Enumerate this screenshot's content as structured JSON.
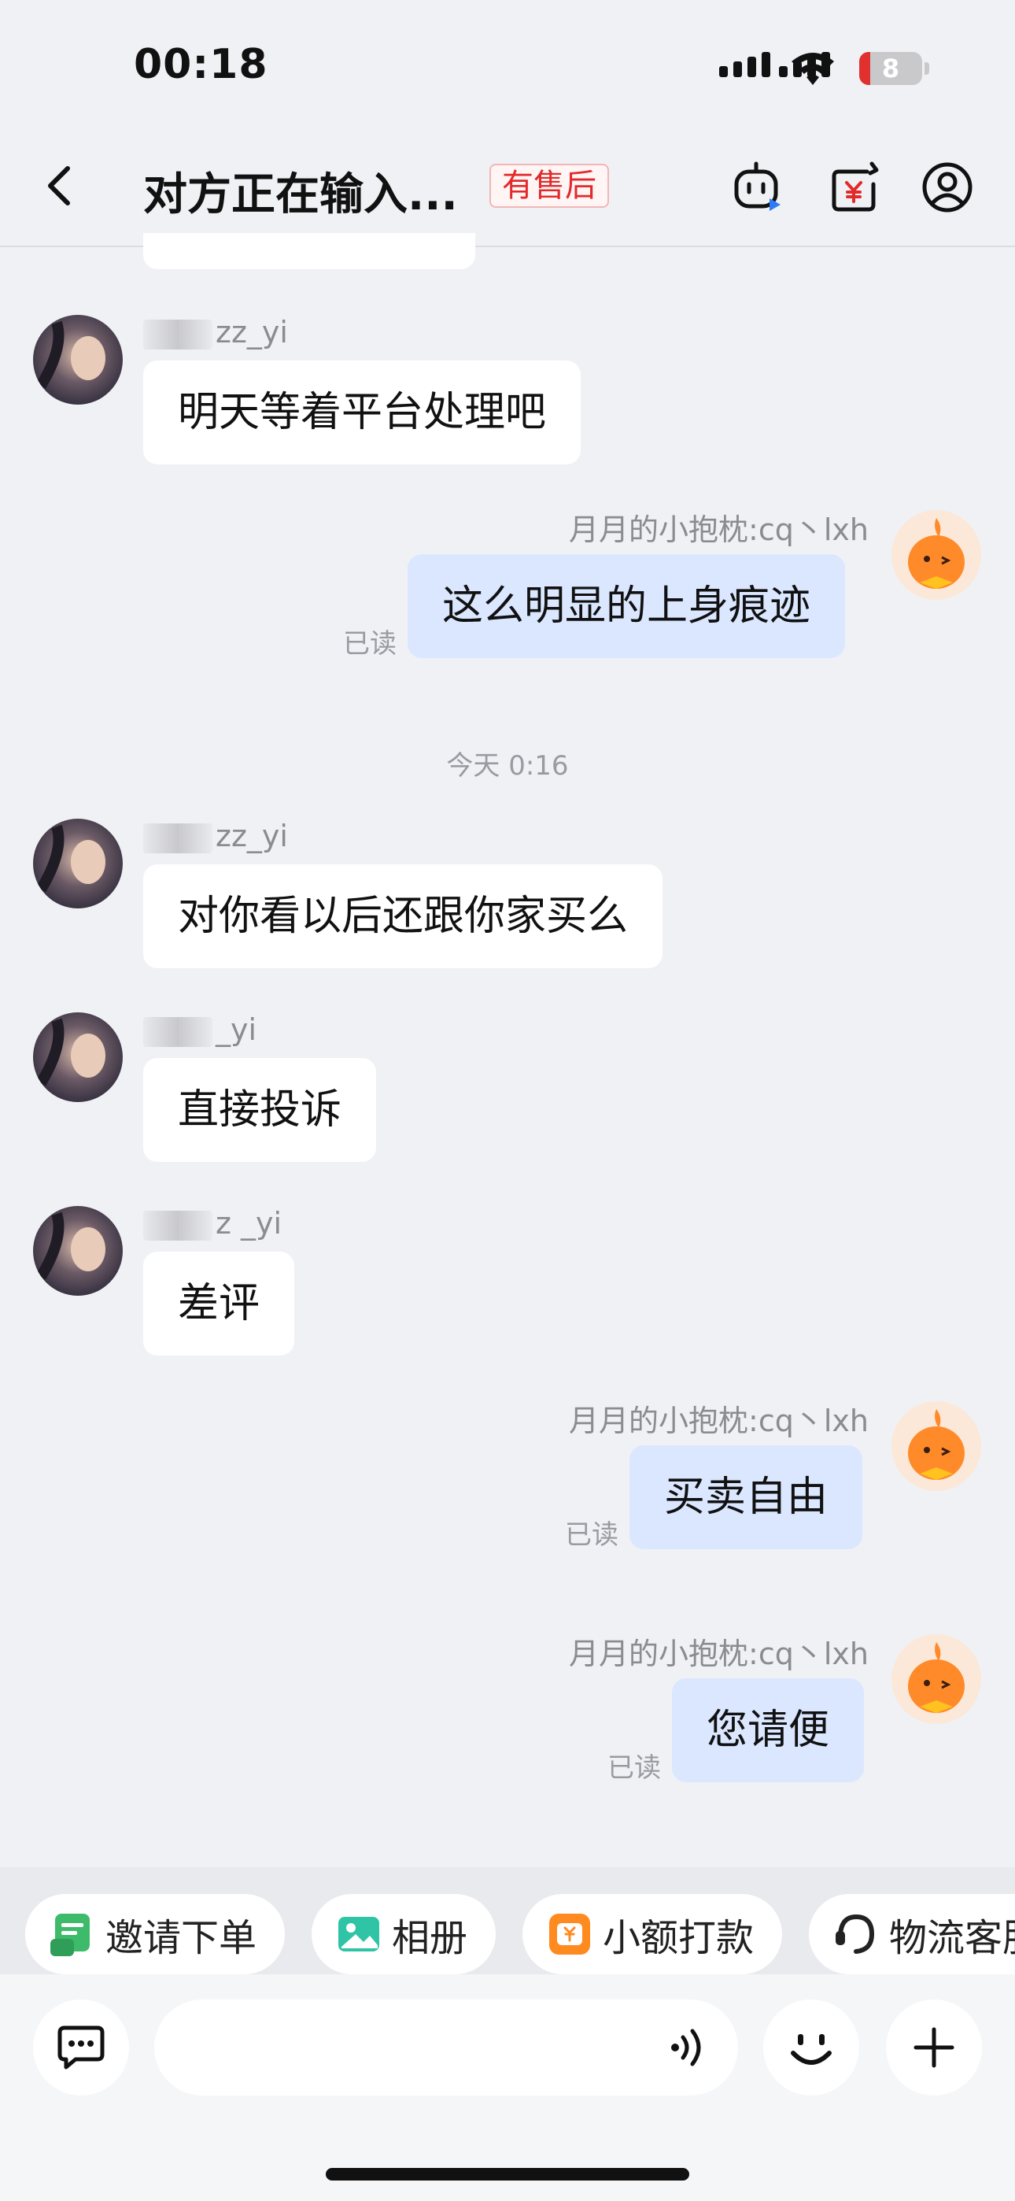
{
  "status_bar": {
    "time": "00:18",
    "battery": "8"
  },
  "header": {
    "title": "对方正在输入...",
    "badge": "有售后"
  },
  "timestamp_separator": "今天 0:16",
  "messages": [
    {
      "direction": "incoming",
      "sender_visible": "zz_yi",
      "text": "明天等着平台处理吧"
    },
    {
      "direction": "outgoing",
      "sender": "月月的小抱枕:cq丶lxh",
      "text": "这么明显的上身痕迹",
      "status": "已读"
    },
    {
      "direction": "incoming",
      "sender_visible": "zz_yi",
      "text": "对你看以后还跟你家买么"
    },
    {
      "direction": "incoming",
      "sender_visible": "_yi",
      "text": "直接投诉"
    },
    {
      "direction": "incoming",
      "sender_visible": "z _yi",
      "text": "差评"
    },
    {
      "direction": "outgoing",
      "sender": "月月的小抱枕:cq丶lxh",
      "text": "买卖自由",
      "status": "已读"
    },
    {
      "direction": "outgoing",
      "sender": "月月的小抱枕:cq丶lxh",
      "text": "您请便",
      "status": "已读"
    }
  ],
  "shortcuts": [
    {
      "label": "邀请下单",
      "icon": "invite-order-icon",
      "color": "#3dbb6b"
    },
    {
      "label": "相册",
      "icon": "album-icon",
      "color": "#2ec4a5"
    },
    {
      "label": "小额打款",
      "icon": "small-payment-icon",
      "color": "#ff8a1f"
    },
    {
      "label": "物流客服",
      "icon": "logistics-service-icon",
      "color": "#222222"
    }
  ],
  "input": {
    "placeholder": ""
  },
  "colors": {
    "outgoing_bubble": "#dbe7ff",
    "incoming_bubble": "#ffffff",
    "badge_red": "#e22a2a",
    "background": "#f0f1f5"
  }
}
